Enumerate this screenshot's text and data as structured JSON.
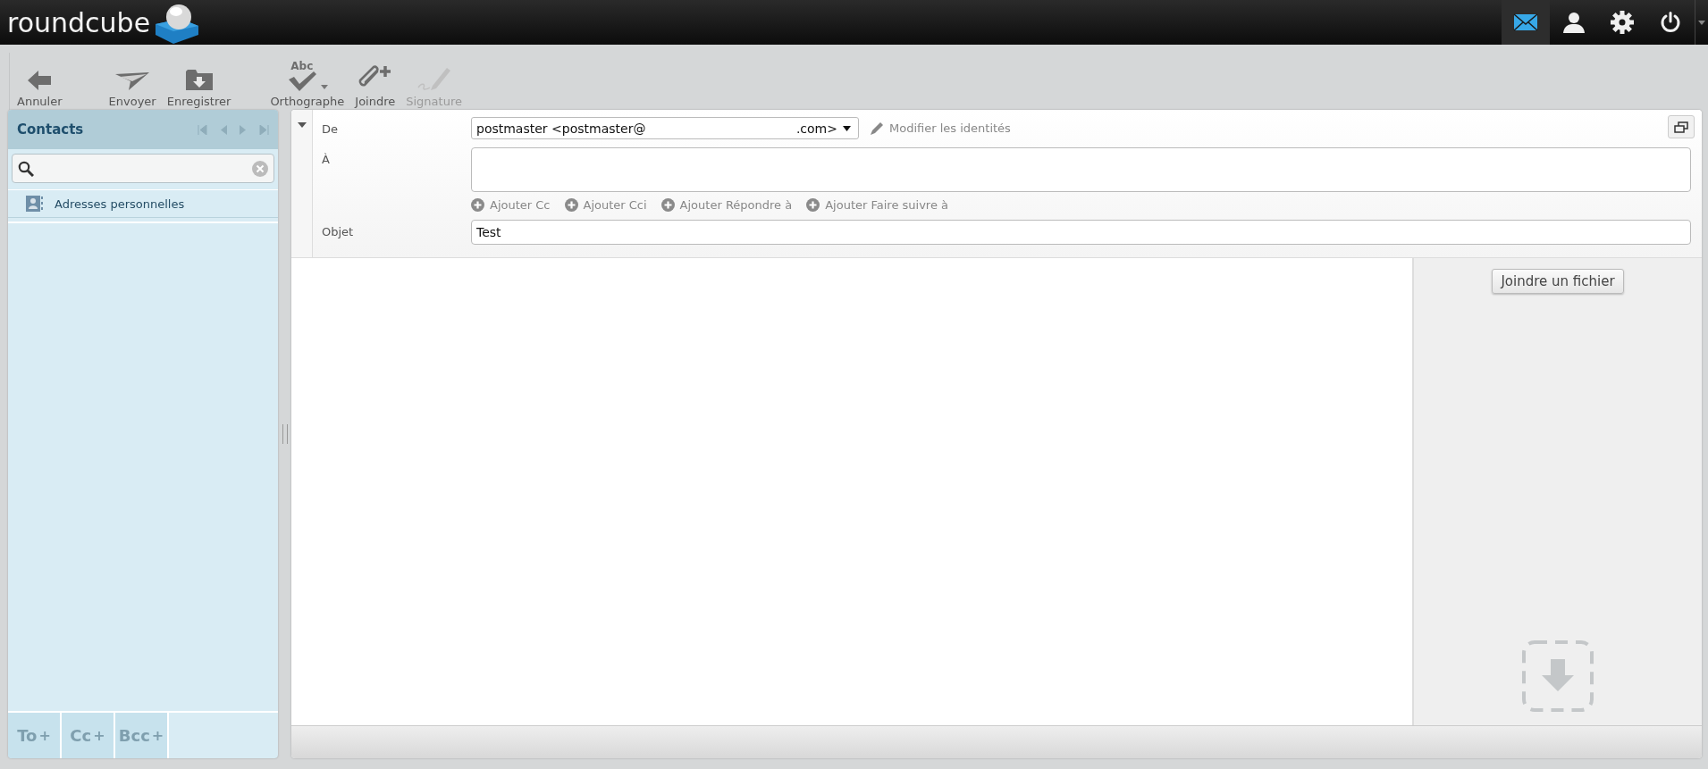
{
  "logo": {
    "text": "roundcube"
  },
  "nav": [
    {
      "kind": "mail",
      "selected": true
    },
    {
      "kind": "contacts",
      "selected": false
    },
    {
      "kind": "settings",
      "selected": false
    },
    {
      "kind": "logout",
      "selected": false
    }
  ],
  "toolbar": [
    {
      "kind": "cancel",
      "label": "Annuler",
      "disabled": false,
      "menu": false
    },
    {
      "kind": "send",
      "label": "Envoyer",
      "disabled": false,
      "menu": false
    },
    {
      "kind": "save",
      "label": "Enregistrer",
      "disabled": false,
      "menu": false
    },
    {
      "kind": "spell",
      "label": "Orthographe",
      "icon_text": "Abc",
      "disabled": false,
      "menu": true
    },
    {
      "kind": "attach",
      "label": "Joindre",
      "disabled": false,
      "menu": false
    },
    {
      "kind": "signature",
      "label": "Signature",
      "disabled": true,
      "menu": false
    }
  ],
  "contacts": {
    "title": "Contacts",
    "pager_disabled": true,
    "items": [
      {
        "label": "Adresses personnelles",
        "selected": false
      }
    ],
    "footer": [
      {
        "label": "To",
        "plus": "+",
        "disabled": true
      },
      {
        "label": "Cc",
        "plus": "+",
        "disabled": true
      },
      {
        "label": "Bcc",
        "plus": "+",
        "disabled": true
      }
    ]
  },
  "compose": {
    "headers_expanded": true,
    "from": {
      "label": "De",
      "value_start": "postmaster <postmaster@",
      "value_end": ".com>"
    },
    "edit_identities": "Modifier les identités",
    "to": {
      "label": "À"
    },
    "add_links": [
      "Ajouter Cc",
      "Ajouter Cci",
      "Ajouter Répondre à",
      "Ajouter Faire suivre à"
    ],
    "subject": {
      "label": "Objet",
      "value": "Test"
    },
    "attach_button": "Joindre un fichier"
  }
}
